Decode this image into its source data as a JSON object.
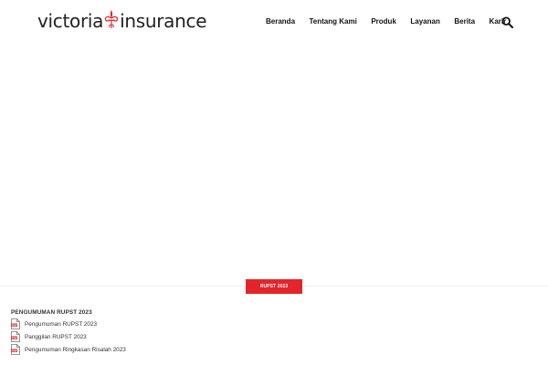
{
  "brand": {
    "logo_left": "victoria",
    "logo_right": "insurance",
    "accent_color": "#e3252b"
  },
  "nav": {
    "items": [
      "Beranda",
      "Tentang Kami",
      "Produk",
      "Layanan",
      "Berita",
      "Karir"
    ],
    "search_icon": "magnifier-icon"
  },
  "tabs": {
    "active_label": "RUPST 2023"
  },
  "section": {
    "title": "PENGUMUMAN RUPST 2023",
    "documents": [
      {
        "label": "Pengumuman RUPST 2023",
        "icon": "pdf-file-icon"
      },
      {
        "label": "Panggilan RUPST 2023",
        "icon": "pdf-file-icon"
      },
      {
        "label": "Pengumuman Ringkasan Risalah 2023",
        "icon": "pdf-file-icon"
      }
    ]
  }
}
